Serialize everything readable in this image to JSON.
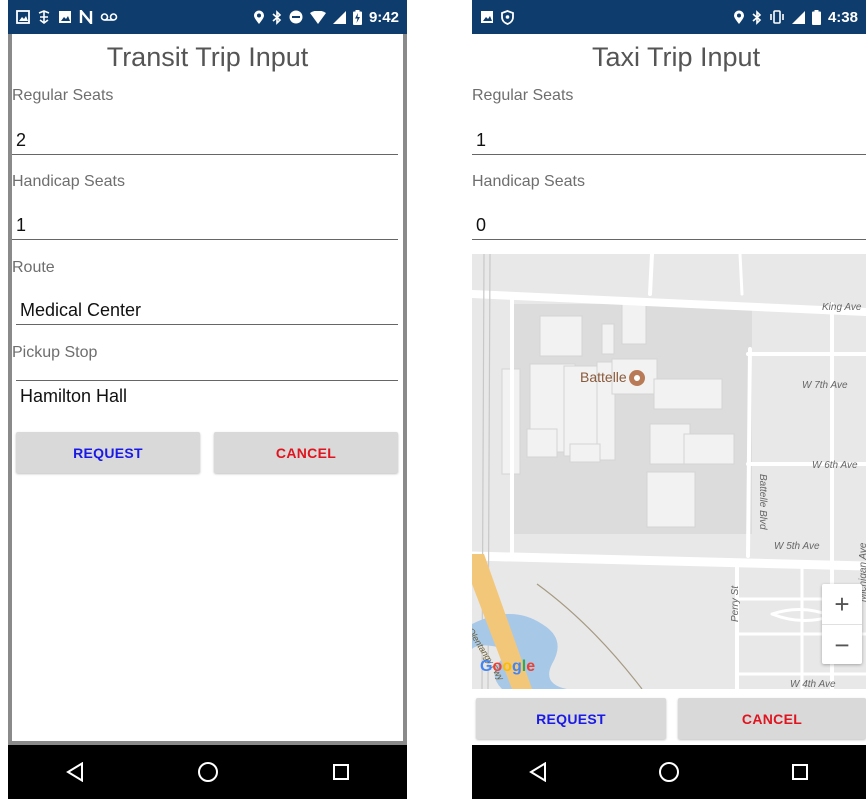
{
  "left_phone": {
    "status_bar": {
      "left_icons": [
        "image-icon",
        "device-icon",
        "image-icon",
        "n-icon",
        "voicemail-icon"
      ],
      "right_icons": [
        "location-icon",
        "bluetooth-icon",
        "do-not-disturb-icon",
        "wifi-icon",
        "signal-icon",
        "battery-charging-icon"
      ],
      "time": "9:42"
    },
    "title": "Transit Trip Input",
    "fields": {
      "regular_seats": {
        "label": "Regular Seats",
        "value": "2"
      },
      "handicap_seats": {
        "label": "Handicap Seats",
        "value": "1"
      },
      "route": {
        "label": "Route",
        "value": "Medical Center"
      },
      "pickup_stop": {
        "label": "Pickup Stop",
        "value": "Hamilton Hall"
      }
    },
    "buttons": {
      "request": "REQUEST",
      "cancel": "CANCEL"
    }
  },
  "right_phone": {
    "status_bar": {
      "left_icons": [
        "image-icon",
        "vpn-icon"
      ],
      "right_icons": [
        "location-icon",
        "bluetooth-icon",
        "vibrate-icon",
        "signal-icon",
        "battery-icon"
      ],
      "time": "4:38"
    },
    "title": "Taxi Trip Input",
    "fields": {
      "regular_seats": {
        "label": "Regular Seats",
        "value": "1"
      },
      "handicap_seats": {
        "label": "Handicap Seats",
        "value": "0"
      }
    },
    "map": {
      "poi": "Battelle",
      "streets": {
        "king_ave": "King Ave",
        "w7th": "W 7th Ave",
        "w6th": "W 6th Ave",
        "battelle_blvd": "Battelle Blvd",
        "w5th": "W 5th Ave",
        "perry": "Perry St",
        "olentangy": "Olentangy Fwy",
        "michigan": "Michigan Ave",
        "w4th": "W 4th Ave"
      },
      "attribution": "Google",
      "zoom_in": "+",
      "zoom_out": "−"
    },
    "buttons": {
      "request": "REQUEST",
      "cancel": "CANCEL"
    }
  },
  "nav_bar": {
    "icons": [
      "back-icon",
      "home-icon",
      "recents-icon"
    ]
  },
  "colors": {
    "status_bar": "#0e3c6c",
    "request_text": "#1a1ae6",
    "cancel_text": "#e0141e",
    "button_bg": "#d9d9d9",
    "poi_marker": "#b97a57",
    "water": "#a8c8e8",
    "freeway": "#f3c77a"
  }
}
